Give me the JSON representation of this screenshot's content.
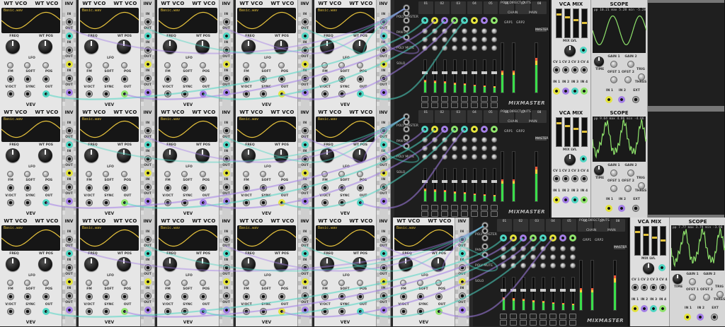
{
  "modules": {
    "wt_vco": {
      "title": "WT VCO",
      "wave_file": "Basic.wav",
      "labels": [
        "FREQ",
        "WT POS",
        "LFO",
        "FM",
        "SOFT",
        "POS",
        "V/OCT",
        "SYNC",
        "OUT"
      ],
      "brand": "VEV"
    },
    "inv": {
      "title": "INV",
      "labels": [
        "IN",
        "OUT"
      ]
    },
    "mixer": {
      "name": "MIXMASTER",
      "channel_labels": [
        "01",
        "02",
        "03",
        "04",
        "05",
        "06",
        "07",
        "08"
      ],
      "labels": [
        "POLY MASTER",
        "PAN CV",
        "POLY MUTE",
        "SOLO",
        "CHAIN",
        "MAIN",
        "GRP1",
        "GRP2",
        "MASTER",
        "POLY DIRECT OUTS"
      ]
    },
    "vca_mix": {
      "title": "VCA MIX",
      "labels": [
        "MIX LVL",
        "CV 1",
        "CV 2",
        "CV 3",
        "CV 4",
        "IN 1",
        "IN 2",
        "IN 3",
        "IN 4"
      ]
    },
    "scope": {
      "title": "SCOPE",
      "readouts": [
        "pp 10.21 max 5.28 min -5.28",
        "pp 9.64 max 4.86 min -4.86",
        "pp 7.77 max 3.79 min -3.98"
      ],
      "labels": [
        "TIME",
        "GAIN 1",
        "GAIN 2",
        "OFST 1",
        "OFST 2",
        "TRIG",
        "THRES",
        "IN 1",
        "IN 2",
        "EXT"
      ]
    }
  },
  "colors": {
    "cable_teal": "#4ed5c2",
    "cable_yellow": "#e3e33b",
    "cable_purple": "#a37ee6",
    "cable_green": "#8ee36b",
    "display_yellow": "#e7c33c",
    "meter_green": "#3adf4a"
  },
  "icons": [
    "knob-icon",
    "jack-icon",
    "waveform-icon",
    "fader-icon"
  ]
}
